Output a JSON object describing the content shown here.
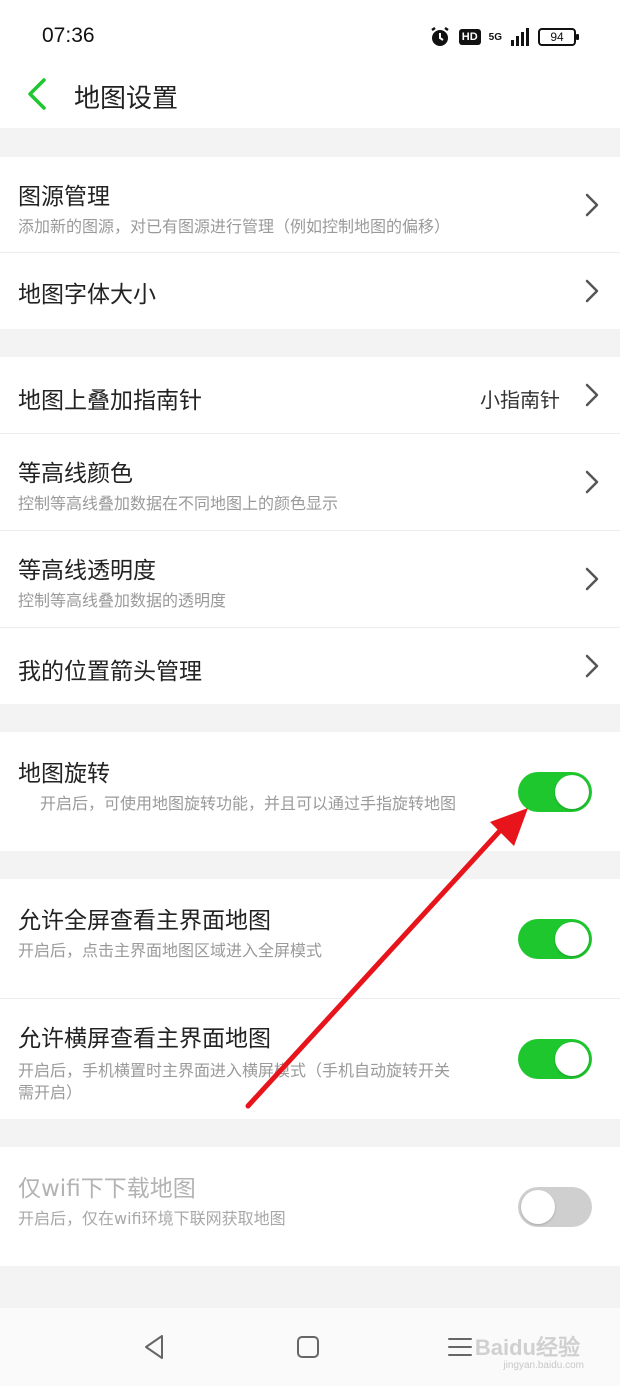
{
  "status": {
    "time": "07:36",
    "hd": "HD",
    "network": "5G",
    "battery": "94"
  },
  "header": {
    "title": "地图设置"
  },
  "rows": {
    "source": {
      "title": "图源管理",
      "sub": "添加新的图源，对已有图源进行管理（例如控制地图的偏移）"
    },
    "font": {
      "title": "地图字体大小"
    },
    "compass": {
      "title": "地图上叠加指南针",
      "value": "小指南针"
    },
    "contour_color": {
      "title": "等高线颜色",
      "sub": "控制等高线叠加数据在不同地图上的颜色显示"
    },
    "contour_alpha": {
      "title": "等高线透明度",
      "sub": "控制等高线叠加数据的透明度"
    },
    "arrow": {
      "title": "我的位置箭头管理"
    },
    "rotate": {
      "title": "地图旋转",
      "sub": "开启后，可使用地图旋转功能，并且可以通过手指旋转地图",
      "on": true
    },
    "fullscreen": {
      "title": "允许全屏查看主界面地图",
      "sub": "开启后，点击主界面地图区域进入全屏模式",
      "on": true
    },
    "landscape": {
      "title": "允许横屏查看主界面地图",
      "sub1": "开启后，手机横置时主界面进入横屏模式（手机自动旋转开关",
      "sub2": "需开启）",
      "on": true
    },
    "wifi": {
      "title": "仅wifi下下载地图",
      "sub": "开启后，仅在wifi环境下联网获取地图",
      "on": false
    }
  },
  "watermark": {
    "main": "Baidu经验",
    "sub": "jingyan.baidu.com"
  },
  "colors": {
    "accent": "#1ec72e",
    "toggle_off": "#cfcfcf",
    "annotation_arrow": "#e8141c"
  }
}
